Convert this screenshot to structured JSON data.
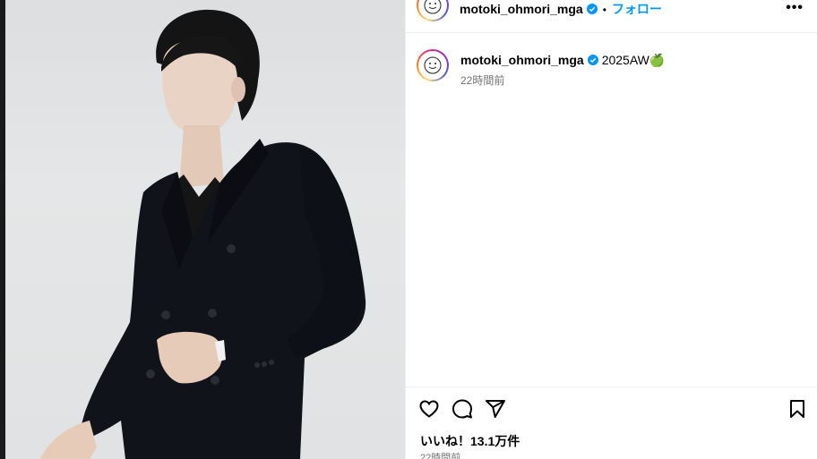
{
  "post": {
    "username": "motoki_ohmori_mga",
    "follow_label": "フォロー",
    "more_label": "•••",
    "separator": "•",
    "caption_text": "2025AW🍏",
    "caption_time": "22時間前",
    "likes_text": "いいね！13.1万件",
    "post_time": "22時間前"
  },
  "icons": {
    "verified": "verified-badge-icon",
    "like": "heart-icon",
    "comment": "comment-bubble-icon",
    "share": "paper-plane-icon",
    "save": "bookmark-icon",
    "more": "more-options-icon"
  },
  "colors": {
    "accent": "#0095f6",
    "verified": "#0095f6",
    "muted": "#737373",
    "border": "#efefef"
  }
}
